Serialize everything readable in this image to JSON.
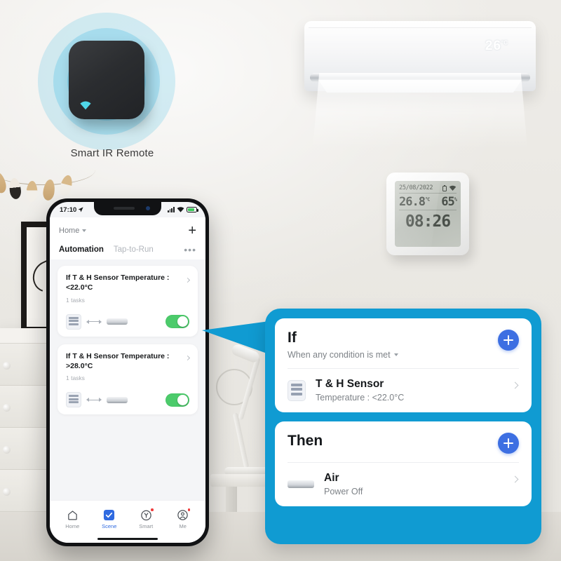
{
  "scene": {
    "ir_remote_label": "Smart IR Remote",
    "ac_display": "26",
    "ac_display_unit": "°C"
  },
  "sensor_device": {
    "date": "25/08/2022",
    "temperature": "26.8",
    "temperature_unit": "°C",
    "humidity": "65",
    "humidity_unit": "%",
    "clock": "08:26",
    "battery_icon": "battery-icon",
    "wifi_icon": "wifi-icon"
  },
  "phone": {
    "statusbar": {
      "time": "17:10",
      "location_icon": "location-arrow-icon",
      "signal_icon": "signal-bars-icon",
      "wifi_icon": "wifi-icon",
      "battery_icon": "battery-charging-icon"
    },
    "header": {
      "home_label": "Home",
      "home_caret_icon": "chevron-down-icon",
      "add_icon": "plus-icon",
      "more_icon": "more-dots-icon"
    },
    "tabs": [
      {
        "label": "Automation",
        "active": true
      },
      {
        "label": "Tap-to-Run",
        "active": false
      }
    ],
    "automations": [
      {
        "title": "If T & H Sensor Temperature : <22.0°C",
        "tasks": "1 tasks",
        "chevron_icon": "chevron-right-icon",
        "source_icon": "th-sensor-icon",
        "link_icon": "double-arrow-icon",
        "target_icon": "air-conditioner-icon",
        "toggle": "on"
      },
      {
        "title": "If T & H Sensor Temperature : >28.0°C",
        "tasks": "1 tasks",
        "chevron_icon": "chevron-right-icon",
        "source_icon": "th-sensor-icon",
        "link_icon": "double-arrow-icon",
        "target_icon": "air-conditioner-icon",
        "toggle": "on"
      }
    ],
    "navbar": [
      {
        "label": "Home",
        "icon": "home-icon",
        "active": false,
        "badge": false
      },
      {
        "label": "Scene",
        "icon": "scene-check-icon",
        "active": true,
        "badge": false
      },
      {
        "label": "Smart",
        "icon": "smart-clock-icon",
        "active": false,
        "badge": true
      },
      {
        "label": "Me",
        "icon": "profile-icon",
        "active": false,
        "badge": true
      }
    ]
  },
  "panel": {
    "if_card": {
      "title": "If",
      "subtitle": "When any condition is met",
      "subtitle_caret_icon": "chevron-down-icon",
      "add_icon": "plus-icon",
      "row": {
        "icon": "th-sensor-icon",
        "name": "T & H Sensor",
        "desc": "Temperature : <22.0°C",
        "chevron_icon": "chevron-right-icon"
      }
    },
    "then_card": {
      "title": "Then",
      "add_icon": "plus-icon",
      "row": {
        "icon": "air-conditioner-icon",
        "name": "Air",
        "desc": "Power Off",
        "chevron_icon": "chevron-right-icon"
      }
    }
  },
  "colors": {
    "panel_blue": "#109BD2",
    "add_button_blue": "#3D6FE2",
    "toggle_green": "#4CCB6B",
    "active_tab_blue": "#2F6AE0",
    "badge_red": "#EF3B3B"
  }
}
